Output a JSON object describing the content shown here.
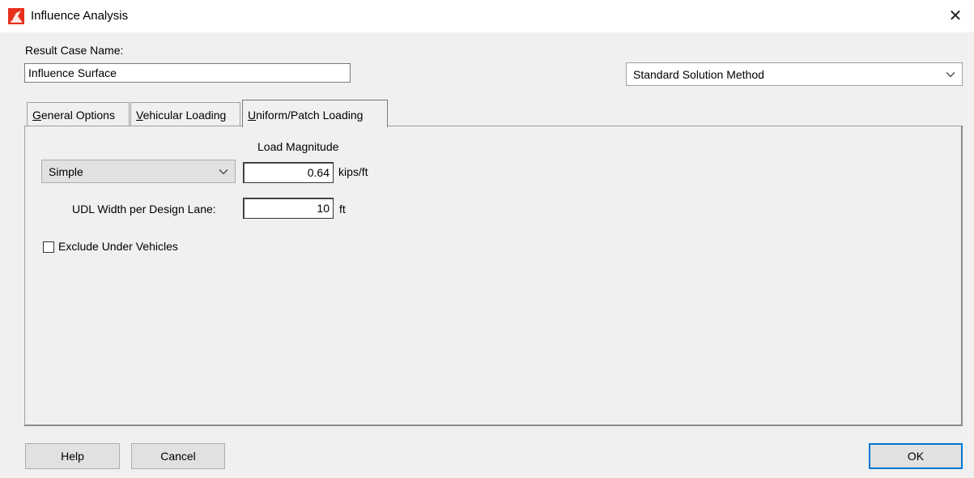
{
  "window": {
    "title": "Influence Analysis",
    "close_icon": "close-icon"
  },
  "result_case": {
    "label": "Result Case Name:",
    "value": "Influence Surface"
  },
  "solution_method": {
    "selected": "Standard Solution Method"
  },
  "tabs": [
    {
      "prefix": "",
      "underline": "G",
      "rest": "eneral Options"
    },
    {
      "prefix": "",
      "underline": "V",
      "rest": "ehicular Loading"
    },
    {
      "prefix": "",
      "underline": "U",
      "rest": "niform/Patch Loading"
    }
  ],
  "uniform": {
    "load_type": "Simple",
    "load_magnitude_label": "Load Magnitude",
    "load_magnitude_value": "0.64",
    "load_magnitude_unit": "kips/ft",
    "udl_width_label": "UDL Width per Design Lane:",
    "udl_width_value": "10",
    "udl_width_unit": "ft",
    "exclude_label": "Exclude Under Vehicles",
    "exclude_checked": false
  },
  "buttons": {
    "help": "Help",
    "cancel": "Cancel",
    "ok": "OK"
  },
  "colors": {
    "accent": "#0078d7",
    "app_icon": "#e8301c"
  }
}
